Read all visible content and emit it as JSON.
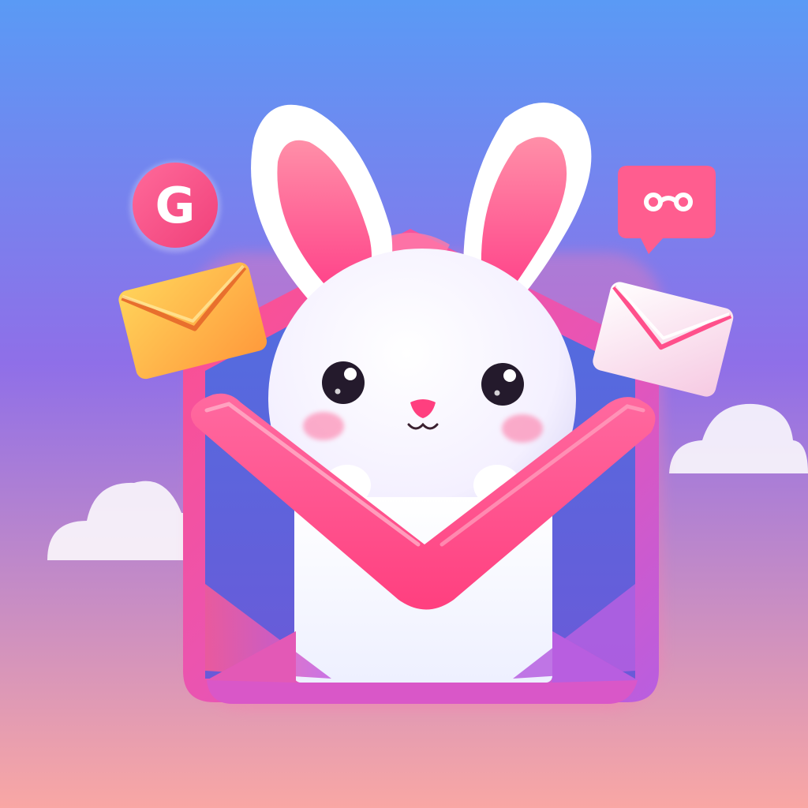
{
  "illustration": {
    "subject": "bunny-in-mail-envelope",
    "icons": {
      "main": "envelope-icon",
      "mascot": "bunny-icon",
      "badge_left": "g-badge-icon",
      "badge_right": "chat-bubble-icon",
      "small_left": "yellow-envelope-icon",
      "small_right": "white-envelope-icon",
      "clouds": "cloud-icon"
    },
    "badge_left_letter": "G",
    "colors": {
      "sky_top": "#5a9af5",
      "sky_mid": "#8f6fe8",
      "sky_bottom": "#f58fb0",
      "accent_pink": "#ff4f8b",
      "envelope_violet": "#c05de0",
      "bunny_white": "#ffffff",
      "ear_inner": "#ff5c98",
      "yellow_envelope": "#ffb33a"
    }
  }
}
